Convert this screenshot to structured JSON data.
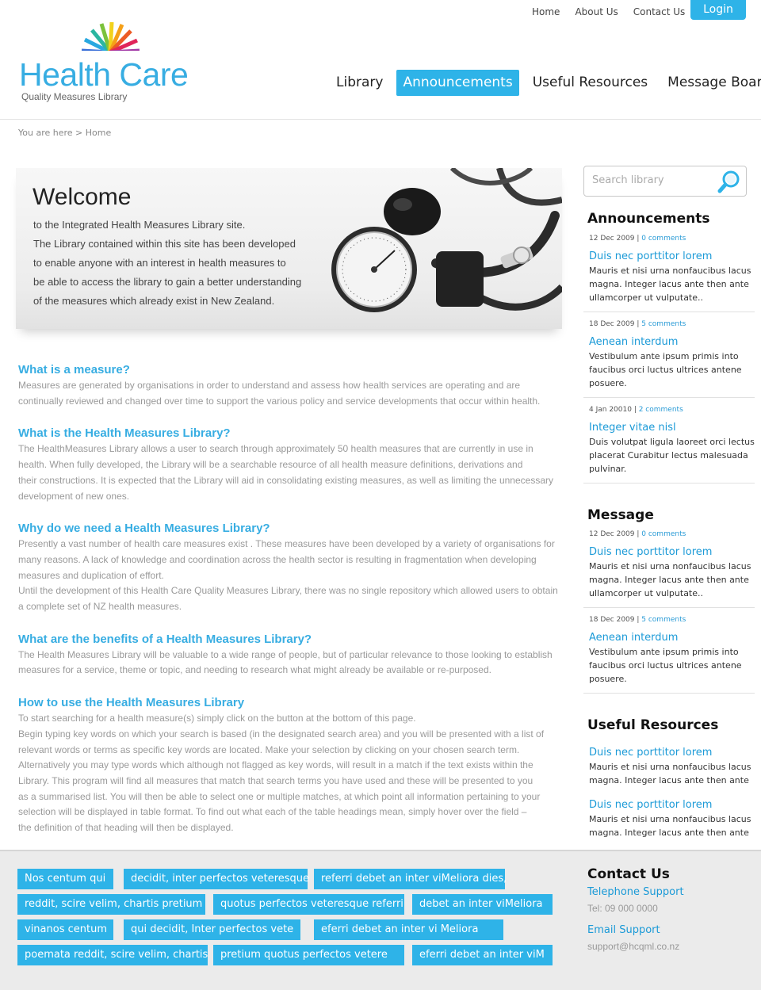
{
  "top_nav": {
    "home": "Home",
    "about": "About Us",
    "contact": "Contact Us",
    "login": "Login"
  },
  "logo": {
    "title": "Health Care",
    "subtitle": "Quality Measures Library"
  },
  "main_nav": [
    "Library",
    "Announcements",
    "Useful Resources",
    "Message Board"
  ],
  "main_nav_active": "Announcements",
  "breadcrumb": "You are here > Home",
  "welcome": {
    "title": "Welcome",
    "lines": [
      "to the Integrated Health Measures Library site.",
      "The Library contained within this site has been developed",
      "to enable anyone with an interest in health measures to",
      "be able to access the library to gain a better understanding",
      "of the measures which already exist in New Zealand."
    ]
  },
  "sections": [
    {
      "heading": "What is a measure?",
      "lines": [
        "Measures are generated by organisations in order to understand and assess how health services are operating and are",
        "continually reviewed and changed over time to support the various policy and service developments that occur within health."
      ]
    },
    {
      "heading": "What is the Health Measures Library?",
      "lines": [
        "The HealthMeasures Library allows a user to search through approximately 50 health measures that are currently in use in",
        "health. When fully developed, the Library will be a searchable resource of all health measure definitions, derivations and",
        "their constructions. It is expected that the Library will aid in consolidating existing measures, as well as limiting the unnecessary",
        "development of new ones."
      ]
    },
    {
      "heading": "Why do we need a Health Measures Library?",
      "lines": [
        "Presently a vast number of health care measures exist . These measures have been developed by a variety of organisations for",
        "many reasons. A lack of knowledge and coordination across the health sector is resulting in fragmentation when developing",
        "measures and duplication of effort.",
        "Until the development of this Health Care Quality Measures Library, there was no single repository which allowed users to obtain",
        "a complete set of NZ health measures."
      ]
    },
    {
      "heading": "What are the benefits of a Health Measures Library?",
      "lines": [
        "The Health Measures Library will be valuable to a wide range of people, but of particular relevance to those looking to establish",
        "measures for a service, theme or topic, and needing to research what might already be available or re-purposed."
      ]
    },
    {
      "heading": "How to use the Health Measures Library",
      "lines": [
        "To start searching for a health measure(s) simply click on the button at the bottom of this page.",
        "Begin typing key words on which your search is based (in the designated search area) and you will be presented with a list of",
        "relevant words or terms as specific key words are located.  Make your selection by clicking on your chosen search term.",
        "Alternatively you may type words which although not flagged as key words, will result in a match if the text exists within the",
        "Library. This program will find all measures that match that search terms you have used and these will be presented to you",
        "as a summarised list. You will then be able to select one or multiple matches, at which point all information pertaining to your",
        "selection will be displayed in table format. To find out what each of the table headings mean, simply hover over the field –",
        "the definition of that heading will then be displayed."
      ]
    }
  ],
  "search": {
    "placeholder": "Search library"
  },
  "announcements": {
    "heading": "Announcements",
    "items": [
      {
        "date": "12 Dec 2009",
        "comments": "0 comments",
        "title": "Duis nec porttitor lorem",
        "lines": [
          "Mauris et nisi urna nonfaucibus lacus",
          "magna. Integer lacus ante then ante",
          "ullamcorper ut vulputate.."
        ]
      },
      {
        "date": "18 Dec 2009",
        "comments": "5 comments",
        "title": "Aenean interdum",
        "lines": [
          "Vestibulum ante ipsum primis into",
          "faucibus orci luctus ultrices antene",
          "posuere."
        ]
      },
      {
        "date": "4 Jan 20010",
        "comments": "2 comments",
        "title": "Integer vitae nisl",
        "lines": [
          "Duis volutpat ligula laoreet orci lectus",
          "placerat Curabitur lectus malesuada",
          "pulvinar."
        ]
      }
    ]
  },
  "message": {
    "heading": "Message",
    "items": [
      {
        "date": "12 Dec 2009",
        "comments": "0 comments",
        "title": "Duis nec porttitor lorem",
        "lines": [
          "Mauris et nisi urna nonfaucibus lacus",
          "magna. Integer lacus ante then ante",
          "ullamcorper ut vulputate.."
        ]
      },
      {
        "date": "18 Dec 2009",
        "comments": "5 comments",
        "title": "Aenean interdum",
        "lines": [
          "Vestibulum ante ipsum primis into",
          "faucibus orci luctus ultrices antene",
          "posuere."
        ]
      }
    ]
  },
  "resources": {
    "heading": "Useful Resources",
    "items": [
      {
        "title": "Duis nec porttitor lorem",
        "lines": [
          "Mauris et nisi urna nonfaucibus lacus",
          "magna. Integer lacus ante then ante"
        ]
      },
      {
        "title": "Duis nec porttitor lorem",
        "lines": [
          "Mauris et nisi urna nonfaucibus lacus",
          "magna. Integer lacus ante then ante"
        ]
      }
    ]
  },
  "footer_tags": [
    [
      "Nos centum qui",
      "decidit, inter perfectos veteresque",
      "referri debet an inter viMeliora dies,"
    ],
    [
      "reddit, scire velim, chartis pretium",
      "quotus perfectos veteresque referri",
      "debet an inter viMeliora"
    ],
    [
      "vinanos centum",
      "qui decidit, Inter perfectos vete",
      "eferri debet an inter vi Meliora"
    ],
    [
      "poemata reddit, scire velim, chartis",
      "pretium quotus perfectos vetere",
      "eferri debet an inter viM"
    ]
  ],
  "contact": {
    "heading": "Contact Us",
    "phone_label": "Telephone Support",
    "phone": "Tel: 09 000 0000",
    "email_label": "Email Support",
    "email": "support@hcqml.co.nz"
  },
  "colors": {
    "accent": "#2eb3e8",
    "link": "#1b9ad7",
    "heading": "#37ade2"
  }
}
